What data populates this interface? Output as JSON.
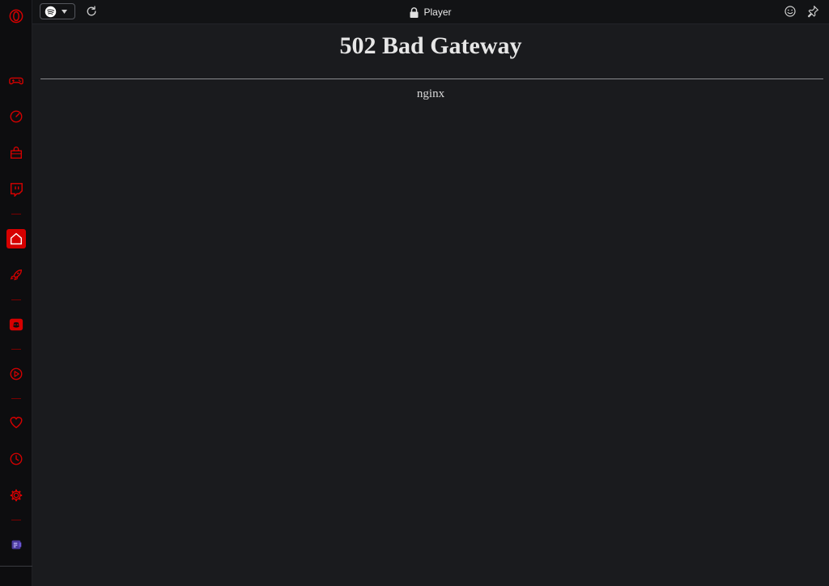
{
  "window": {
    "title": "Player",
    "lock_icon": "lock-icon"
  },
  "toolbar": {
    "player_service_icon": "spotify-icon",
    "dropdown_icon": "caret-down-icon",
    "reload_icon": "reload-icon",
    "emoji_icon": "smiley-icon",
    "pin_icon": "pin-icon"
  },
  "sidebar": {
    "accent_color": "#d60000",
    "items": [
      {
        "icon": "opera-gx-logo-icon"
      },
      {
        "icon": "gamepad-icon"
      },
      {
        "icon": "speedometer-icon"
      },
      {
        "icon": "shopping-bag-icon"
      },
      {
        "icon": "twitch-icon"
      },
      {
        "icon": "home-icon",
        "active": true
      },
      {
        "icon": "rocket-icon"
      },
      {
        "icon": "discord-icon"
      },
      {
        "icon": "play-circle-icon"
      },
      {
        "icon": "heart-icon"
      },
      {
        "icon": "clock-icon"
      },
      {
        "icon": "gear-icon"
      },
      {
        "icon": "extension-icon"
      }
    ]
  },
  "page": {
    "heading": "502 Bad Gateway",
    "server": "nginx"
  }
}
